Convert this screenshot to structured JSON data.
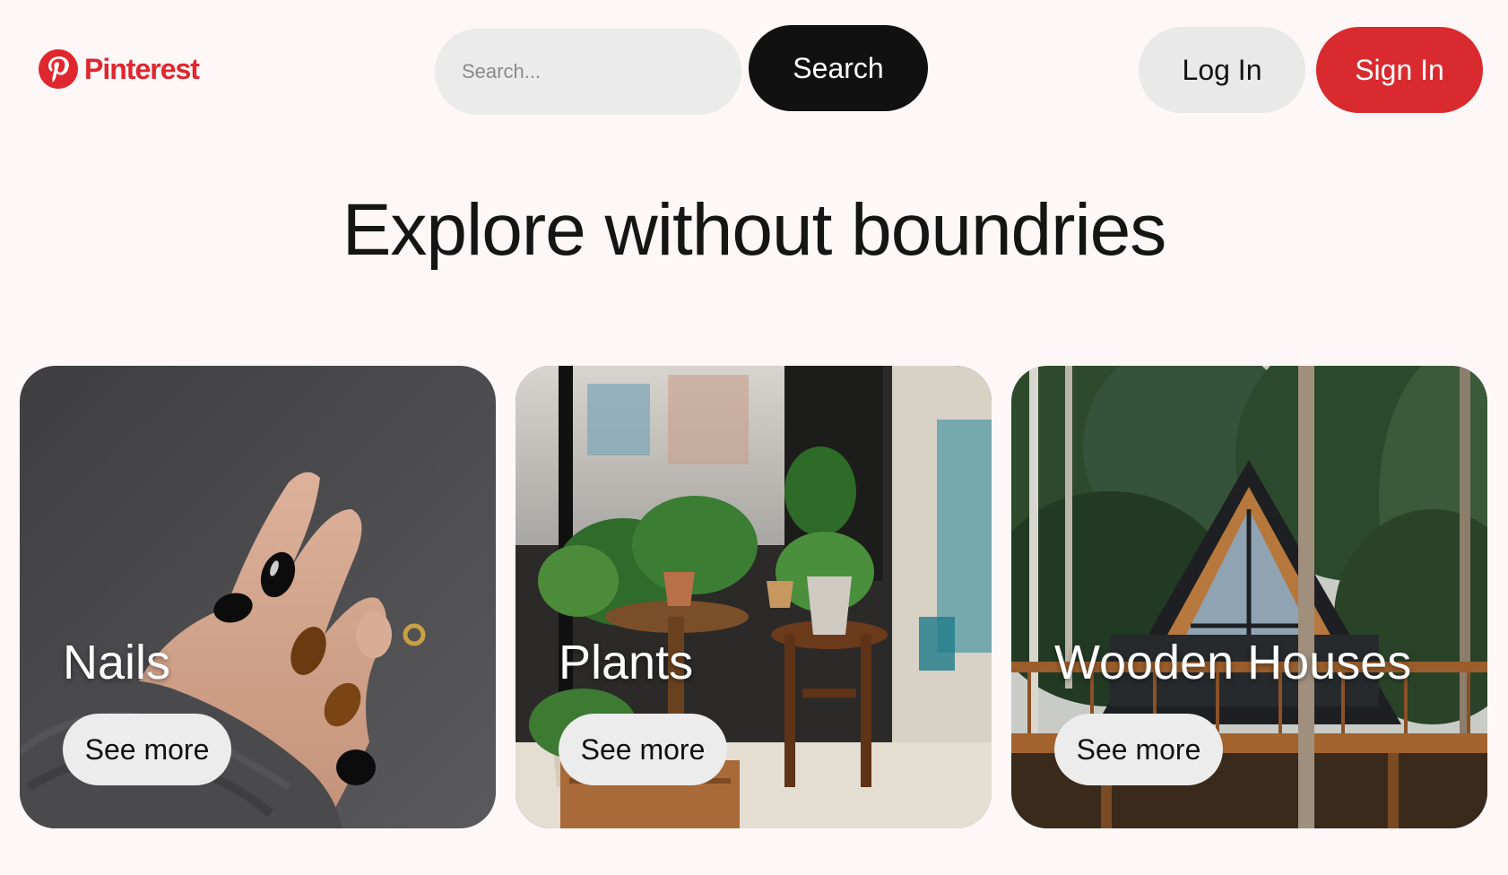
{
  "brand": {
    "name": "Pinterest",
    "color": "#e0262e",
    "logo_icon": "pinterest-p-icon"
  },
  "search": {
    "placeholder": "Search...",
    "button_label": "Search"
  },
  "auth": {
    "login_label": "Log In",
    "signin_label": "Sign In",
    "signin_color": "#d92b2f"
  },
  "hero": {
    "title": "Explore without boundries"
  },
  "cards": [
    {
      "title": "Nails",
      "button_label": "See more",
      "image": "manicured-hand-photo"
    },
    {
      "title": "Plants",
      "button_label": "See more",
      "image": "potted-plants-photo"
    },
    {
      "title": "Wooden Houses",
      "button_label": "See more",
      "image": "a-frame-cabin-photo"
    }
  ]
}
